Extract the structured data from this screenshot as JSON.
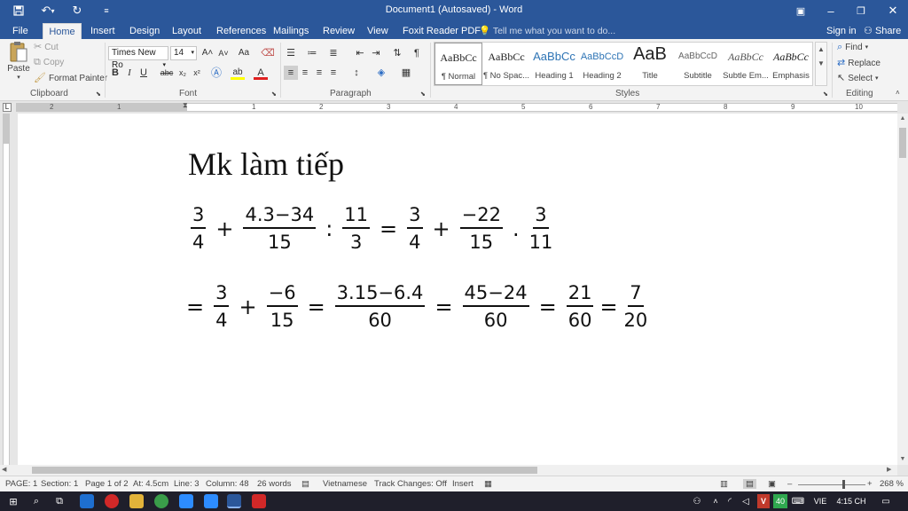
{
  "window": {
    "title": "Document1 (Autosaved) - Word",
    "save_icon": "floppy-disk-icon",
    "undo_icon": "undo-arrow-icon",
    "redo_icon": "redo-arrow-icon",
    "customize_icon": "chevron-down-icon",
    "ribbon_options_icon": "ribbon-display-icon",
    "minimize": "–",
    "restore": "❐",
    "close": "✕"
  },
  "tabs": [
    {
      "label": "File"
    },
    {
      "label": "Home"
    },
    {
      "label": "Insert"
    },
    {
      "label": "Design"
    },
    {
      "label": "Layout"
    },
    {
      "label": "References"
    },
    {
      "label": "Mailings"
    },
    {
      "label": "Review"
    },
    {
      "label": "View"
    },
    {
      "label": "Foxit Reader PDF"
    }
  ],
  "tell_me": "Tell me what you want to do...",
  "sign_in": "Sign in",
  "share": "Share",
  "clipboard": {
    "paste": "Paste",
    "cut": "Cut",
    "copy": "Copy",
    "format_painter": "Format Painter",
    "group_label": "Clipboard"
  },
  "font": {
    "name": "Times New Ro",
    "size": "14",
    "bold": "B",
    "italic": "I",
    "underline": "U",
    "strike": "abc",
    "subscript": "x₂",
    "superscript": "x²",
    "grow": "A˄",
    "shrink": "A˅",
    "case": "Aa",
    "group_label": "Font"
  },
  "paragraph": {
    "group_label": "Paragraph",
    "pilcrow": "¶"
  },
  "styles": {
    "group_label": "Styles",
    "items": [
      {
        "preview": "AaBbCc",
        "name": "¶ Normal"
      },
      {
        "preview": "AaBbCc",
        "name": "¶ No Spac..."
      },
      {
        "preview": "AaBbCc",
        "name": "Heading 1"
      },
      {
        "preview": "AaBbCcD",
        "name": "Heading 2"
      },
      {
        "preview": "AaB",
        "name": "Title"
      },
      {
        "preview": "AaBbCcD",
        "name": "Subtitle"
      },
      {
        "preview": "AaBbCc",
        "name": "Subtle Em..."
      },
      {
        "preview": "AaBbCc",
        "name": "Emphasis"
      }
    ]
  },
  "editing": {
    "find": "Find",
    "replace": "Replace",
    "select": "Select",
    "group_label": "Editing"
  },
  "ruler": {
    "numbers": [
      "2",
      "1",
      "1",
      "2",
      "3",
      "4",
      "5",
      "6",
      "7",
      "8",
      "9",
      "10"
    ]
  },
  "document": {
    "heading": "Mk làm tiếp",
    "line1": {
      "f1": {
        "n": "3",
        "d": "4"
      },
      "op1": "+",
      "f2": {
        "n": "4.3−34",
        "d": "15"
      },
      "op2": ":",
      "f3": {
        "n": "11",
        "d": "3"
      },
      "op3": "=",
      "f4": {
        "n": "3",
        "d": "4"
      },
      "op4": "+",
      "f5": {
        "n": "−22",
        "d": "15"
      },
      "op5": ".",
      "f6": {
        "n": "3",
        "d": "11"
      }
    },
    "line2": {
      "op0": "=",
      "f1": {
        "n": "3",
        "d": "4"
      },
      "op1": "+",
      "f2": {
        "n": "−6",
        "d": "15"
      },
      "op2": "=",
      "f3": {
        "n": "3.15−6.4",
        "d": "60"
      },
      "op3": "=",
      "f4": {
        "n": "45−24",
        "d": "60"
      },
      "op4": "=",
      "f5": {
        "n": "21",
        "d": "60"
      },
      "op5": "=",
      "f6": {
        "n": "7",
        "d": "20"
      }
    }
  },
  "status": {
    "page": "PAGE: 1",
    "section": "Section: 1",
    "page_of": "Page 1 of 2",
    "at": "At: 4.5cm",
    "line": "Line: 3",
    "column": "Column: 48",
    "words": "26 words",
    "language": "Vietnamese",
    "track": "Track Changes: Off",
    "insert": "Insert",
    "zoom": "268 %"
  },
  "taskbar": {
    "lang": "VIE",
    "time": "4:15 CH",
    "badge": "40"
  }
}
